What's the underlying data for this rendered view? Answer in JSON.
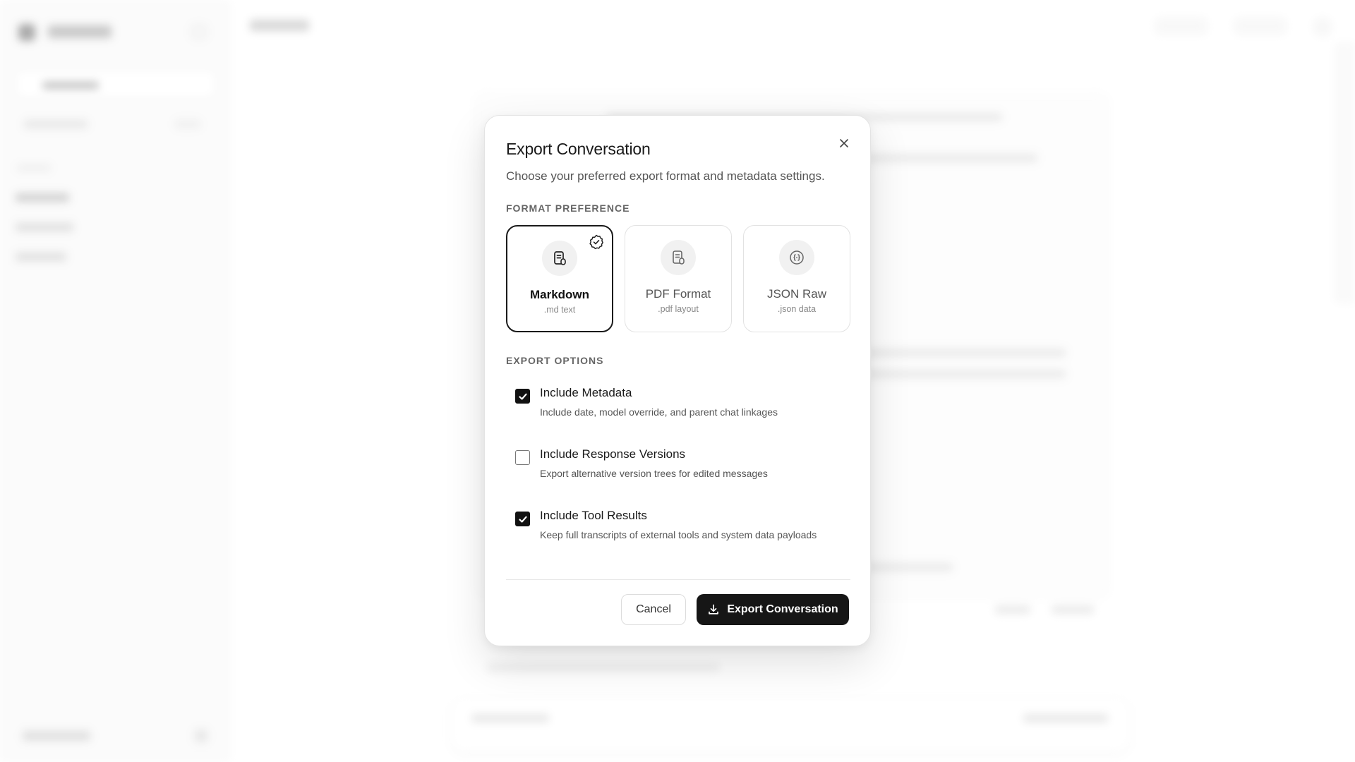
{
  "dialog": {
    "title": "Export Conversation",
    "subtitle": "Choose your preferred export format and metadata settings.",
    "close_icon": "close-icon"
  },
  "format_section": {
    "label": "FORMAT PREFERENCE",
    "selected": "markdown",
    "options": [
      {
        "id": "markdown",
        "label": "Markdown",
        "ext": ".md text",
        "icon": "markdown-document-icon",
        "selected": true
      },
      {
        "id": "pdf",
        "label": "PDF Format",
        "ext": ".pdf layout",
        "icon": "pdf-document-icon",
        "selected": false
      },
      {
        "id": "json",
        "label": "JSON Raw",
        "ext": ".json data",
        "icon": "json-braces-icon",
        "selected": false
      }
    ]
  },
  "options_section": {
    "label": "EXPORT OPTIONS",
    "options": [
      {
        "title": "Include Metadata",
        "description": "Include date, model override, and parent chat linkages",
        "checked": true
      },
      {
        "title": "Include Response Versions",
        "description": "Export alternative version trees for edited messages",
        "checked": false
      },
      {
        "title": "Include Tool Results",
        "description": "Keep full transcripts of external tools and system data payloads",
        "checked": true
      }
    ]
  },
  "footer": {
    "cancel_label": "Cancel",
    "export_label": "Export Conversation",
    "export_icon": "download-icon"
  }
}
